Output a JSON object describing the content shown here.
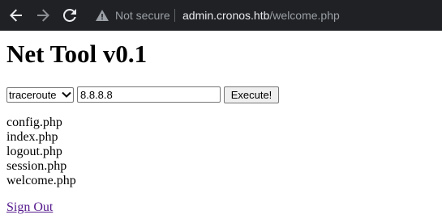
{
  "browser": {
    "security_label": "Not secure",
    "url_host": "admin.cronos.htb",
    "url_path": "/welcome.php",
    "back_icon": "arrow-left-icon",
    "forward_icon": "arrow-right-icon",
    "reload_icon": "reload-icon",
    "security_icon": "warning-triangle-icon"
  },
  "page": {
    "title": "Net Tool v0.1",
    "form": {
      "command_selected": "traceroute",
      "host_value": "8.8.8.8",
      "execute_label": "Execute!"
    },
    "files": [
      "config.php",
      "index.php",
      "logout.php",
      "session.php",
      "welcome.php"
    ],
    "signout_label": "Sign Out"
  },
  "colors": {
    "toolbar_bg": "#202124",
    "link_visited": "#551a8b"
  }
}
